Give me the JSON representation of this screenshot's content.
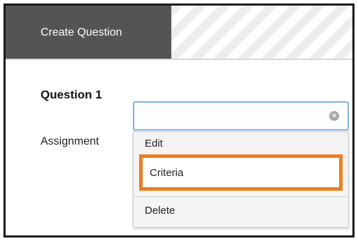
{
  "header": {
    "tab_label": "Create Question"
  },
  "content": {
    "question_title": "Question 1",
    "assignment_label": "Assignment"
  },
  "dropdown": {
    "value": "",
    "clear_icon": "clear-circle-icon",
    "items": [
      "Edit",
      "Criteria",
      "Delete"
    ],
    "highlighted_item": "Criteria",
    "highlight_color": "#f07d1e"
  }
}
